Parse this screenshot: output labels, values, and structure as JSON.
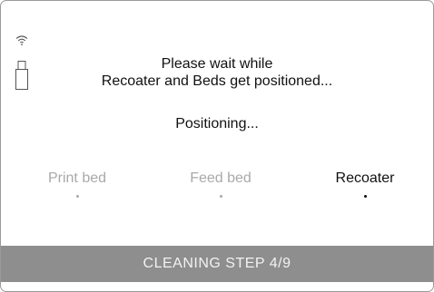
{
  "icons": {
    "wifi": "wifi-icon",
    "usb": "usb-drive-icon"
  },
  "message": {
    "line1": "Please wait while",
    "line2": "Recoater and Beds get positioned..."
  },
  "status": "Positioning...",
  "components": [
    {
      "label": "Print bed",
      "active": false
    },
    {
      "label": "Feed bed",
      "active": false
    },
    {
      "label": "Recoater",
      "active": true
    }
  ],
  "step_bar": {
    "text": "CLEANING STEP 4/9"
  },
  "colors": {
    "active_text": "#111111",
    "inactive_text": "#a9a9a9",
    "step_bar_background": "#8e8e8e",
    "step_bar_text": "#f2f2f2"
  }
}
